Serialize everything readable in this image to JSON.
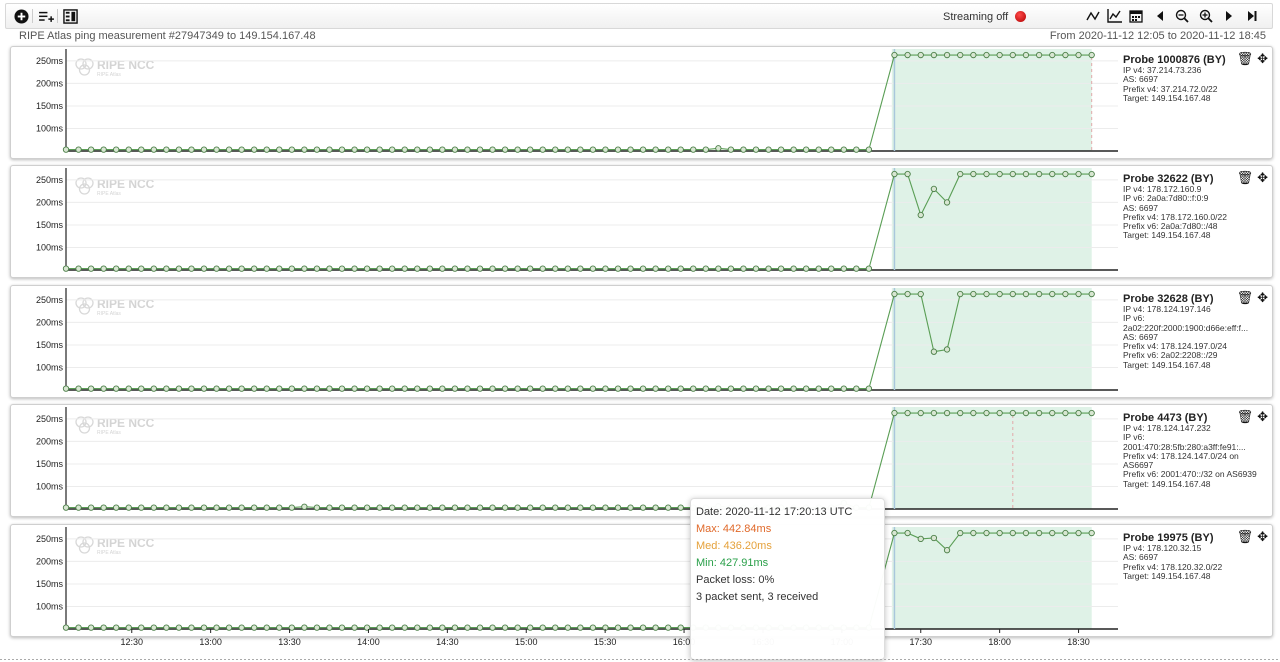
{
  "toolbar": {
    "add_icon": "plus-circle-icon",
    "list_icon": "add-list-icon",
    "layout_icon": "layout-icon",
    "streaming_label": "Streaming off",
    "streaming_color": "#d00000",
    "right_icons": [
      "line-chart-icon",
      "area-chart-icon",
      "calendar-icon",
      "step-back-icon",
      "zoom-out-icon",
      "zoom-in-icon",
      "step-forward-icon",
      "jump-end-icon"
    ]
  },
  "header": {
    "title": "RIPE Atlas ping measurement #27947349 to 149.154.167.48",
    "range": "From 2020-11-12 12:05 to 2020-11-12 18:45"
  },
  "colors": {
    "line": "#5a9e55",
    "marker_fill": "#d8e6d2",
    "marker_stroke": "#4c7f48",
    "shade": "#dff2e7",
    "selection": "#a9c7dc",
    "dashed": "#e2a9a9"
  },
  "watermark": {
    "title": "RIPE NCC",
    "subtitle": "RIPE Atlas"
  },
  "chart_data": [
    {
      "type": "line",
      "probe": "Probe 1000876 (BY)",
      "info": [
        "IP v4: 37.214.73.236",
        "AS: 6697",
        "Prefix v4: 37.214.72.0/22",
        "Target: 149.154.167.48"
      ],
      "y_ticks": [
        "250ms",
        "200ms",
        "150ms",
        "100ms"
      ],
      "ylim": [
        50,
        272
      ],
      "xlim": [
        "12:05",
        "18:45"
      ],
      "x_ticks": [
        "12:30",
        "13:00",
        "13:30",
        "14:00",
        "14:30",
        "15:00",
        "15:30",
        "16:00",
        "16:30",
        "17:00",
        "17:30",
        "18:00",
        "18:30"
      ],
      "shaded_from": "17:19",
      "shaded_to": "18:35",
      "selection_line": "17:20",
      "dashed_line": "18:35",
      "series": [
        {
          "from": "12:05",
          "to": "17:15",
          "step_min": 4.77,
          "values": [
            53
          ],
          "bumps": {
            "52": 56
          }
        },
        {
          "x": [
            "17:20",
            "17:25",
            "17:30",
            "17:35",
            "17:40",
            "17:45",
            "17:50",
            "17:55",
            "18:00",
            "18:05",
            "18:10",
            "18:15",
            "18:20",
            "18:25",
            "18:30",
            "18:35"
          ],
          "values": [
            263,
            263,
            263,
            263,
            263,
            263,
            263,
            263,
            263,
            263,
            263,
            263,
            263,
            263,
            263,
            263
          ]
        }
      ]
    },
    {
      "type": "line",
      "probe": "Probe 32622 (BY)",
      "info": [
        "IP v4: 178.172.160.9",
        "IP v6: 2a0a:7d80::f:0:9",
        "AS: 6697",
        "Prefix v4: 178.172.160.0/22",
        "Prefix v6: 2a0a:7d80::/48",
        "Target: 149.154.167.48"
      ],
      "y_ticks": [
        "250ms",
        "200ms",
        "150ms",
        "100ms"
      ],
      "ylim": [
        50,
        272
      ],
      "xlim": [
        "12:05",
        "18:45"
      ],
      "x_ticks": [
        "12:30",
        "13:00",
        "13:30",
        "14:00",
        "14:30",
        "15:00",
        "15:30",
        "16:00",
        "16:30",
        "17:00",
        "17:30",
        "18:00",
        "18:30"
      ],
      "shaded_from": "17:19",
      "shaded_to": "18:35",
      "selection_line": "17:20",
      "series": [
        {
          "from": "12:05",
          "to": "17:15",
          "step_min": 4.77,
          "values": [
            53
          ]
        },
        {
          "x": [
            "17:20",
            "17:25",
            "17:30",
            "17:35",
            "17:40",
            "17:45",
            "17:50",
            "17:55",
            "18:00",
            "18:05",
            "18:10",
            "18:15",
            "18:20",
            "18:25",
            "18:30",
            "18:35"
          ],
          "values": [
            263,
            263,
            172,
            230,
            200,
            263,
            263,
            263,
            263,
            263,
            263,
            263,
            263,
            263,
            263,
            263
          ]
        }
      ]
    },
    {
      "type": "line",
      "probe": "Probe 32628 (BY)",
      "info": [
        "IP v4: 178.124.197.146",
        "IP v6:",
        "2a02:220f:2000:1900:d66e:eff:f...",
        "AS: 6697",
        "Prefix v4: 178.124.197.0/24",
        "Prefix v6: 2a02:2208::/29",
        "Target: 149.154.167.48"
      ],
      "y_ticks": [
        "250ms",
        "200ms",
        "150ms",
        "100ms"
      ],
      "ylim": [
        50,
        272
      ],
      "xlim": [
        "12:05",
        "18:45"
      ],
      "x_ticks": [
        "12:30",
        "13:00",
        "13:30",
        "14:00",
        "14:30",
        "15:00",
        "15:30",
        "16:00",
        "16:30",
        "17:00",
        "17:30",
        "18:00",
        "18:30"
      ],
      "shaded_from": "17:19",
      "shaded_to": "18:35",
      "selection_line": "17:20",
      "series": [
        {
          "from": "12:05",
          "to": "17:15",
          "step_min": 4.77,
          "values": [
            53
          ]
        },
        {
          "x": [
            "17:20",
            "17:25",
            "17:30",
            "17:35",
            "17:40",
            "17:45",
            "17:50",
            "17:55",
            "18:00",
            "18:05",
            "18:10",
            "18:15",
            "18:20",
            "18:25",
            "18:30",
            "18:35"
          ],
          "values": [
            263,
            263,
            263,
            135,
            140,
            263,
            263,
            263,
            263,
            263,
            263,
            263,
            263,
            263,
            263,
            263
          ]
        }
      ]
    },
    {
      "type": "line",
      "probe": "Probe 4473 (BY)",
      "info": [
        "IP v4: 178.124.147.232",
        "IP v6:",
        "2001:470:28:5fb:280:a3ff:fe91:...",
        "Prefix v4: 178.124.147.0/24 on",
        "AS6697",
        "Prefix v6: 2001:470::/32 on AS6939",
        "Target: 149.154.167.48"
      ],
      "y_ticks": [
        "250ms",
        "200ms",
        "150ms",
        "100ms"
      ],
      "ylim": [
        50,
        272
      ],
      "xlim": [
        "12:05",
        "18:45"
      ],
      "x_ticks": [
        "12:30",
        "13:00",
        "13:30",
        "14:00",
        "14:30",
        "15:00",
        "15:30",
        "16:00",
        "16:30",
        "17:00",
        "17:30",
        "18:00",
        "18:30"
      ],
      "shaded_from": "17:19",
      "shaded_to": "18:35",
      "selection_line": "17:20",
      "dashed_line": "18:05",
      "series": [
        {
          "from": "12:05",
          "to": "17:15",
          "step_min": 4.77,
          "values": [
            53
          ],
          "bumps": {
            "19": 55,
            "52": 56,
            "62": 63,
            "66": 98
          }
        },
        {
          "x": [
            "17:20",
            "17:25",
            "17:30",
            "17:35",
            "17:40",
            "17:45",
            "17:50",
            "17:55",
            "18:00",
            "18:05",
            "18:10",
            "18:15",
            "18:20",
            "18:25",
            "18:30",
            "18:35"
          ],
          "values": [
            263,
            263,
            263,
            263,
            263,
            263,
            263,
            263,
            263,
            263,
            263,
            263,
            263,
            263,
            263,
            263
          ]
        }
      ]
    },
    {
      "type": "line",
      "probe": "Probe 19975 (BY)",
      "info": [
        "IP v4: 178.120.32.15",
        "AS: 6697",
        "Prefix v4: 178.120.32.0/22",
        "Target: 149.154.167.48"
      ],
      "y_ticks": [
        "250ms",
        "200ms",
        "150ms",
        "100ms"
      ],
      "ylim": [
        50,
        272
      ],
      "xlim": [
        "12:05",
        "18:45"
      ],
      "x_ticks": [
        "12:30",
        "13:00",
        "13:30",
        "14:00",
        "14:30",
        "15:00",
        "15:30",
        "16:00",
        "16:30",
        "17:00",
        "17:30",
        "18:00",
        "18:30"
      ],
      "x_tick_labels_visible": true,
      "shaded_from": "17:19",
      "shaded_to": "18:35",
      "selection_line": "17:20",
      "series": [
        {
          "from": "12:05",
          "to": "17:15",
          "step_min": 4.77,
          "values": [
            53
          ]
        },
        {
          "x": [
            "17:20",
            "17:25",
            "17:30",
            "17:35",
            "17:40",
            "17:45",
            "17:50",
            "17:55",
            "18:00",
            "18:05",
            "18:10",
            "18:15",
            "18:20",
            "18:25",
            "18:30",
            "18:35"
          ],
          "values": [
            263,
            263,
            250,
            252,
            225,
            263,
            263,
            263,
            263,
            263,
            263,
            263,
            263,
            263,
            263,
            263
          ]
        }
      ]
    }
  ],
  "tooltip": {
    "date": "Date: 2020-11-12 17:20:13 UTC",
    "max": "Max: 442.84ms",
    "med": "Med: 436.20ms",
    "min": "Min: 427.91ms",
    "loss": "Packet loss: 0%",
    "sent": "3 packet sent, 3 received",
    "max_color": "#e0692a",
    "med_color": "#e5a13a",
    "min_color": "#2aa04a"
  }
}
